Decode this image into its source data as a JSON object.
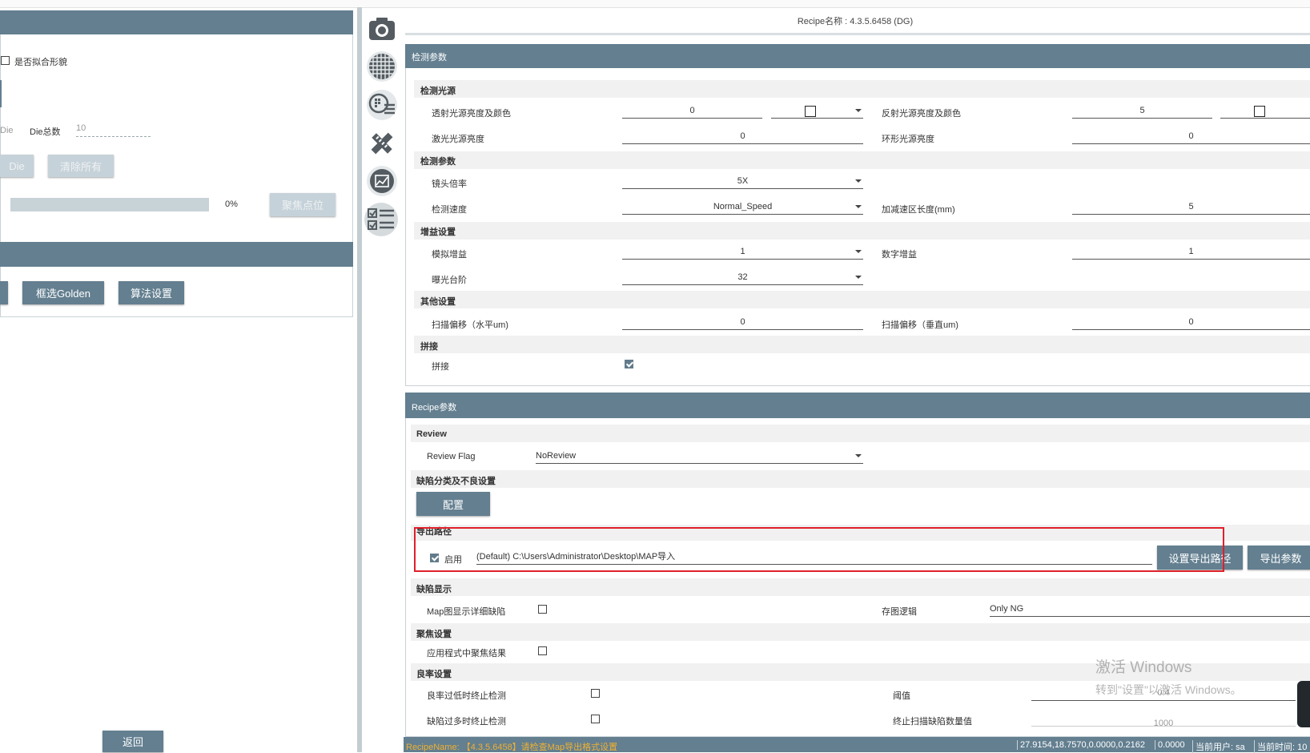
{
  "left": {
    "fit_shape_label": "是否拟合形貌",
    "die_partial": "Die",
    "die_total_label": "Die总数",
    "die_total_value": "10",
    "btn_die_partial": "Die",
    "btn_clear_all": "清除所有",
    "progress_percent": 0,
    "progress_text": "0%",
    "btn_focus_point": "聚焦点位",
    "btn_select_golden": "框选Golden",
    "btn_algo_settings": "算法设置",
    "btn_back": "返回"
  },
  "recipe_name_title": "Recipe名称 : 4.3.5.6458 (DG)",
  "detection_params": {
    "title": "检测参数",
    "light_section": "检测光源",
    "transmit_label": "透射光源亮度及颜色",
    "transmit_value": "0",
    "reflect_label": "反射光源亮度及颜色",
    "reflect_value": "5",
    "laser_label": "激光光源亮度",
    "laser_value": "0",
    "ring_label": "环形光源亮度",
    "ring_value": "0",
    "detect_section": "检测参数",
    "lens_label": "镜头倍率",
    "lens_value": "5X",
    "speed_label": "检测速度",
    "speed_value": "Normal_Speed",
    "accel_label": "加减速区长度(mm)",
    "accel_value": "5",
    "gain_section": "增益设置",
    "analog_gain_label": "模拟增益",
    "analog_gain_value": "1",
    "digital_gain_label": "数字增益",
    "digital_gain_value": "1",
    "exposure_label": "曝光台阶",
    "exposure_value": "32",
    "other_section": "其他设置",
    "offset_h_label": "扫描偏移（水平um)",
    "offset_h_value": "0",
    "offset_v_label": "扫描偏移（垂直um)",
    "offset_v_value": "0",
    "stitch_section": "拼接",
    "stitch_label": "拼接"
  },
  "recipe_params": {
    "title": "Recipe参数",
    "review_section": "Review",
    "review_flag_label": "Review Flag",
    "review_flag_value": "NoReview",
    "defect_section": "缺陷分类及不良设置",
    "config_button": "配置",
    "export_section": "导出路径",
    "enable_label": "启用",
    "export_path": "(Default) C:\\Users\\Administrator\\Desktop\\MAP导入",
    "set_path_button": "设置导出路径",
    "export_params_button": "导出参数",
    "defect_display_section": "缺陷显示",
    "map_detail_label": "Map图显示详细缺陷",
    "save_logic_label": "存图逻辑",
    "save_logic_value": "Only NG",
    "focus_section": "聚焦设置",
    "apply_focus_label": "应用程式中聚焦结果",
    "yield_section": "良率设置",
    "yield_low_label": "良率过低时终止检测",
    "threshold_label": "阈值",
    "threshold_value": "0.4",
    "defect_many_label": "缺陷过多时终止检测",
    "stop_count_label": "终止扫描缺陷数量值",
    "stop_count_value": "1000"
  },
  "watermark": {
    "line1": "激活 Windows",
    "line2": "转到\"设置\"以激活 Windows。"
  },
  "status_bar": {
    "recipe_name": "RecipeName: 【4.3.5.6458】请检查Map导出格式设置",
    "coords": "27.9154,18.7570,0.0000,0.2162",
    "value": "0.0000",
    "user": "当前用户: sa",
    "time": "当前时间: 10"
  },
  "colors": {
    "header": "#637f90",
    "highlight": "#e0202a",
    "status_text": "#f0b030"
  }
}
